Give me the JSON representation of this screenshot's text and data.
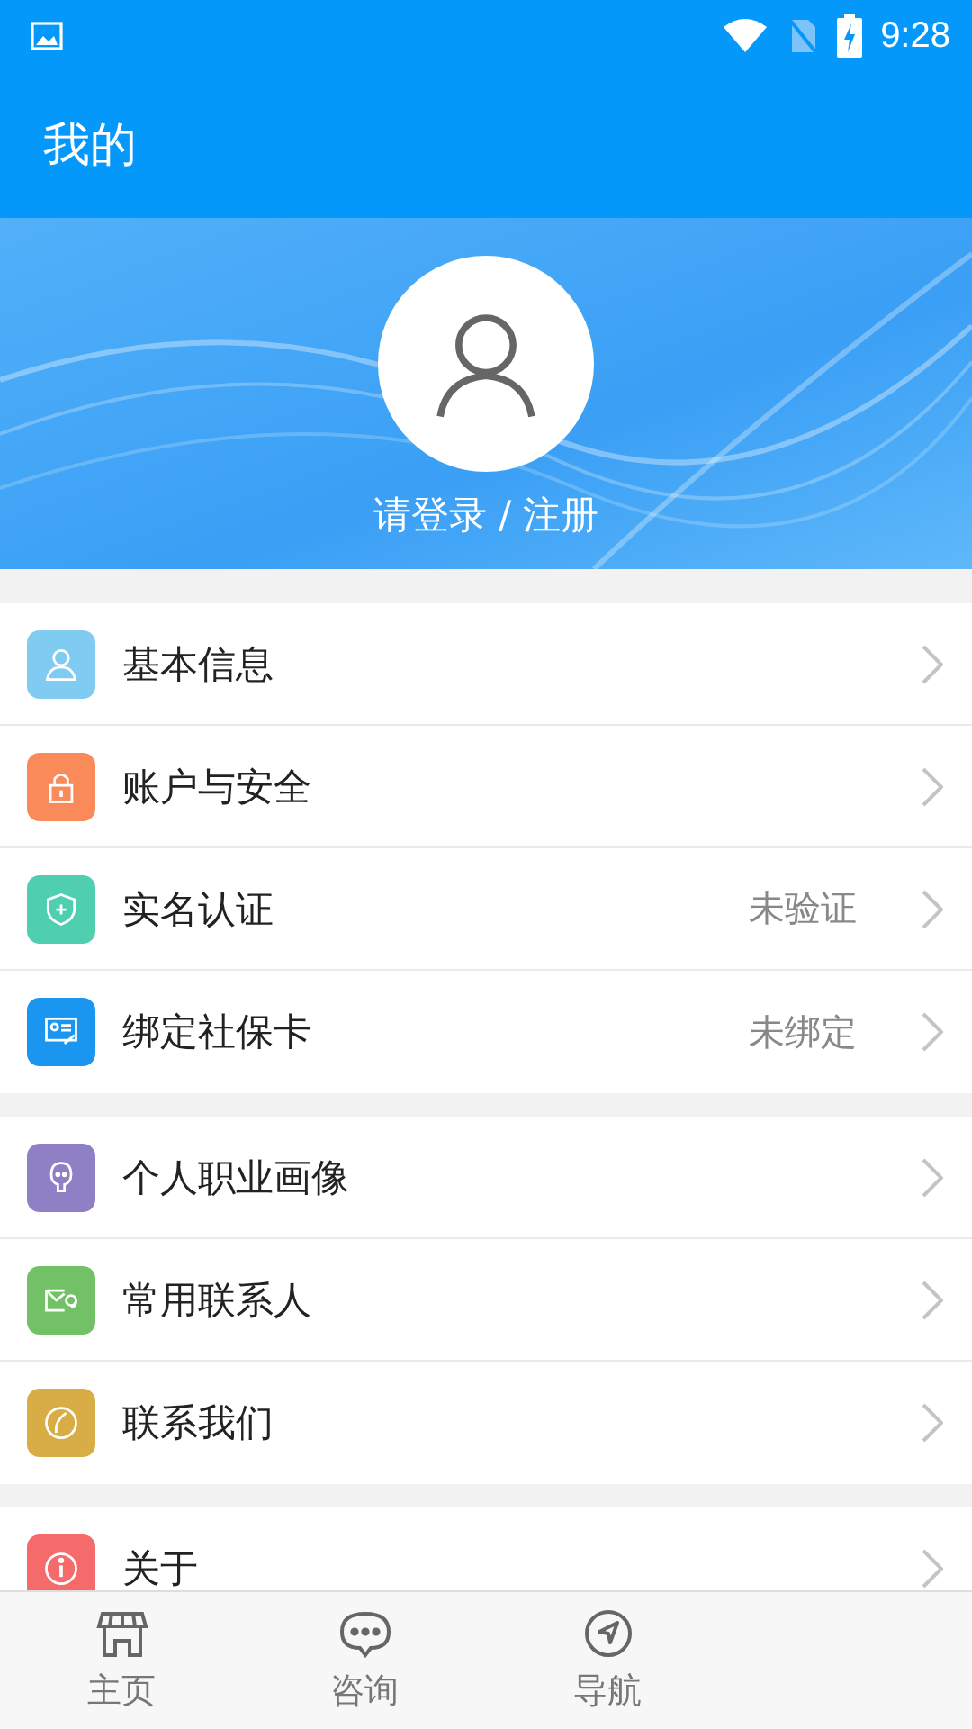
{
  "status_bar": {
    "time": "9:28"
  },
  "header": {
    "title": "我的"
  },
  "profile": {
    "login_text": "请登录 / 注册"
  },
  "groups": [
    {
      "items": [
        {
          "label": "基本信息",
          "kind": "person",
          "color": "#7fcbf2"
        },
        {
          "label": "账户与安全",
          "kind": "lock",
          "color": "#fb8a5a"
        },
        {
          "label": "实名认证",
          "kind": "shield",
          "color": "#4fcfb0",
          "status": "未验证"
        },
        {
          "label": "绑定社保卡",
          "kind": "card",
          "color": "#1a96f0",
          "status": "未绑定"
        }
      ]
    },
    {
      "items": [
        {
          "label": "个人职业画像",
          "kind": "face",
          "color": "#8f7fc4"
        },
        {
          "label": "常用联系人",
          "kind": "mail",
          "color": "#72c167"
        },
        {
          "label": "联系我们",
          "kind": "phone",
          "color": "#d8ad45"
        }
      ]
    },
    {
      "items": [
        {
          "label": "关于",
          "kind": "info",
          "color": "#f56a6a"
        }
      ]
    }
  ],
  "tab_bar": [
    {
      "label": "主页",
      "kind": "store"
    },
    {
      "label": "咨询",
      "kind": "chat"
    },
    {
      "label": "导航",
      "kind": "compass"
    }
  ]
}
